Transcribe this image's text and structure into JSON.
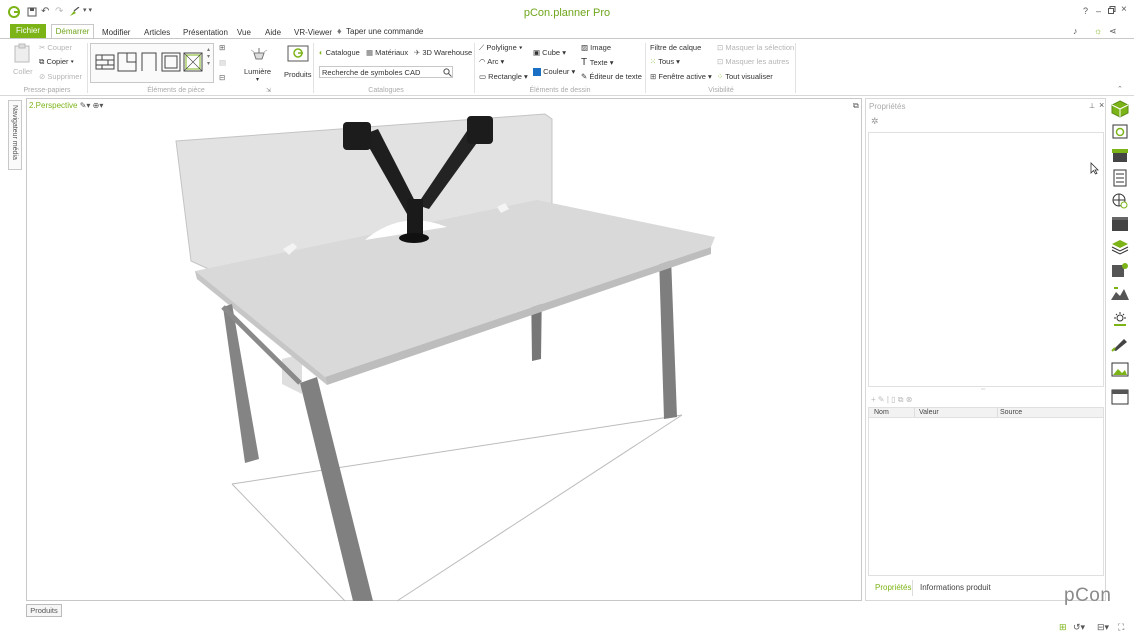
{
  "app": {
    "title": "pCon.planner Pro"
  },
  "titlebar": {
    "help": "?",
    "minimize": "–",
    "restore": "▫",
    "close": "×"
  },
  "menu": {
    "file": "Fichier",
    "tabs": [
      "Démarrer",
      "Modifier",
      "Articles",
      "Présentation",
      "Vue",
      "Aide",
      "VR-Viewer"
    ],
    "command_search": "Taper une commande"
  },
  "ribbon": {
    "clipboard": {
      "paste": "Coller",
      "cut": "Couper",
      "copy": "Copier",
      "delete": "Supprimer",
      "group": "Presse-papiers"
    },
    "room": {
      "group": "Éléments de pièce"
    },
    "light": {
      "label": "Lumière"
    },
    "products": {
      "label": "Produits"
    },
    "catalogues": {
      "catalogue": "Catalogue",
      "materials": "Matériaux",
      "warehouse": "3D Warehouse",
      "search_placeholder": "Recherche de symboles CAD",
      "group": "Catalogues"
    },
    "drawing": {
      "polyline": "Polyligne",
      "arc": "Arc",
      "rectangle": "Rectangle",
      "cube": "Cube",
      "color": "Couleur",
      "image": "Image",
      "text": "Texte",
      "text_editor": "Éditeur de texte",
      "group": "Éléments de dessin"
    },
    "visibility": {
      "layer_filter": "Filtre de calque",
      "all": "Tous",
      "active_window": "Fenêtre active",
      "hide_selection": "Masquer la sélection",
      "hide_others": "Masquer les autres",
      "show_all": "Tout visualiser",
      "group": "Visibilité"
    }
  },
  "left_panel": {
    "media_navigator": "Navigateur média"
  },
  "viewport": {
    "view_name": "2.Perspective"
  },
  "properties": {
    "title": "Propriétés",
    "columns": [
      "Nom",
      "Valeur",
      "Source"
    ],
    "tabs": [
      "Propriétés",
      "Informations produit"
    ]
  },
  "bottom": {
    "produits": "Produits",
    "logo": "pCon"
  },
  "colors": {
    "accent": "#7cb418",
    "brand_text": "#6fa61c"
  }
}
